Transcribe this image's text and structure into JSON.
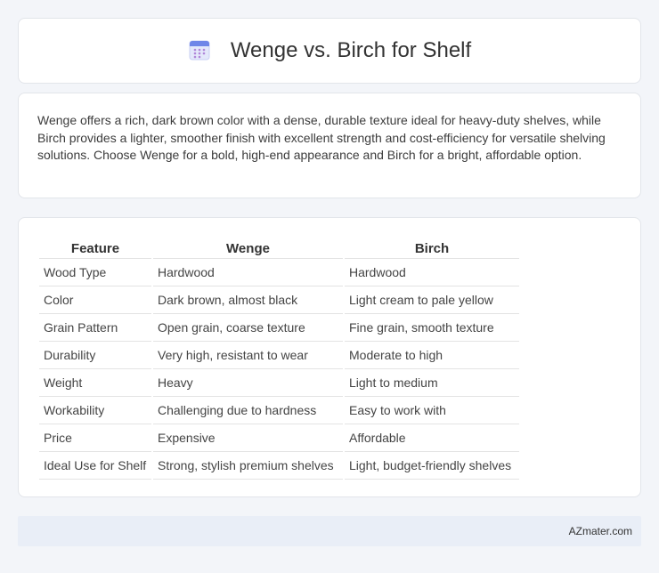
{
  "header": {
    "title": "Wenge vs. Birch for Shelf",
    "icon": "calendar-icon"
  },
  "summary": {
    "text": "Wenge offers a rich, dark brown color with a dense, durable texture ideal for heavy-duty shelves, while Birch provides a lighter, smoother finish with excellent strength and cost-efficiency for versatile shelving solutions. Choose Wenge for a bold, high-end appearance and Birch for a bright, affordable option."
  },
  "table": {
    "headers": [
      "Feature",
      "Wenge",
      "Birch"
    ],
    "rows": [
      [
        "Wood Type",
        "Hardwood",
        "Hardwood"
      ],
      [
        "Color",
        "Dark brown, almost black",
        "Light cream to pale yellow"
      ],
      [
        "Grain Pattern",
        "Open grain, coarse texture",
        "Fine grain, smooth texture"
      ],
      [
        "Durability",
        "Very high, resistant to wear",
        "Moderate to high"
      ],
      [
        "Weight",
        "Heavy",
        "Light to medium"
      ],
      [
        "Workability",
        "Challenging due to hardness",
        "Easy to work with"
      ],
      [
        "Price",
        "Expensive",
        "Affordable"
      ],
      [
        "Ideal Use for Shelf",
        "Strong, stylish premium shelves",
        "Light, budget-friendly shelves"
      ]
    ]
  },
  "footer": {
    "brand": "AZmater.com"
  }
}
